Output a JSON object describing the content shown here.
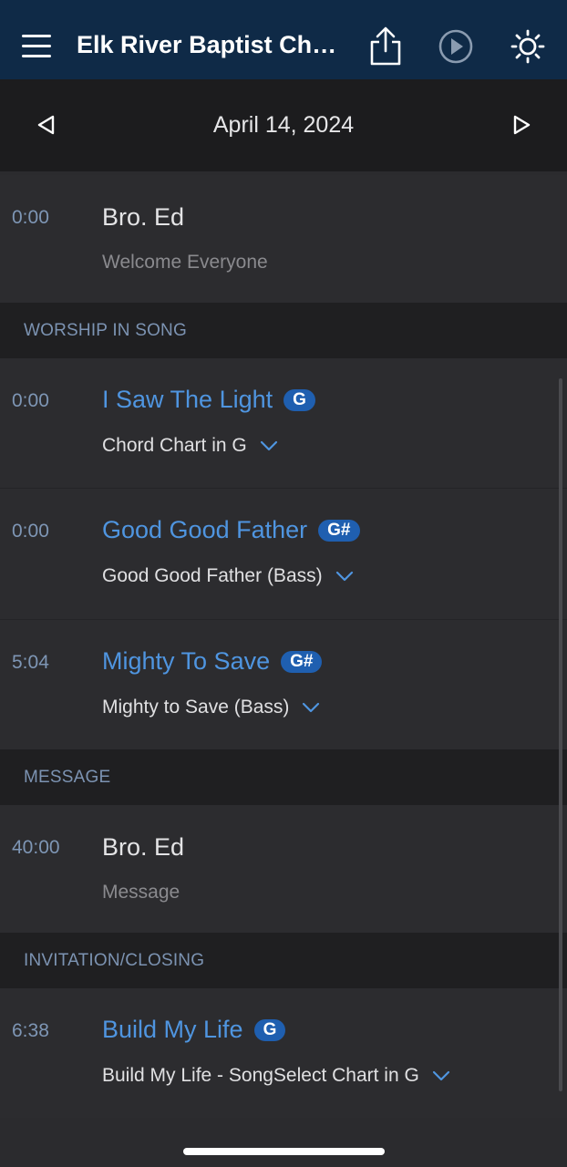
{
  "app_bar": {
    "title": "Elk River Baptist Chur...",
    "icons": [
      "menu-icon",
      "share-icon",
      "play-icon",
      "brightness-icon"
    ],
    "background_color": "#0f2a47"
  },
  "date_bar": {
    "date": "April 14, 2024",
    "icons": [
      "previous-icon",
      "next-icon"
    ]
  },
  "items": [
    {
      "time": "0:00",
      "name": "Bro. Ed",
      "description": "Welcome Everyone"
    }
  ],
  "sections": [
    {
      "label": "WORSHIP IN SONG",
      "songs": [
        {
          "time": "0:00",
          "title": "I Saw The Light",
          "key": "G",
          "arrangement": "Chord Chart in G"
        },
        {
          "time": "0:00",
          "title": "Good Good Father",
          "key": "G#",
          "arrangement": "Good Good Father (Bass)"
        },
        {
          "time": "5:04",
          "title": "Mighty To Save",
          "key": "G#",
          "arrangement": "Mighty to Save (Bass)"
        }
      ]
    },
    {
      "label": "MESSAGE",
      "items": [
        {
          "time": "40:00",
          "name": "Bro. Ed",
          "description": "Message"
        }
      ]
    },
    {
      "label": "INVITATION/CLOSING",
      "songs": [
        {
          "time": "6:38",
          "title": "Build My Life",
          "key": "G",
          "arrangement": "Build My Life - SongSelect Chart in G"
        }
      ]
    }
  ],
  "colors": {
    "accent": "#4f95e0",
    "badge": "#1f5fb0",
    "time_text": "#7e96b5",
    "section_label": "#7c93b2"
  }
}
